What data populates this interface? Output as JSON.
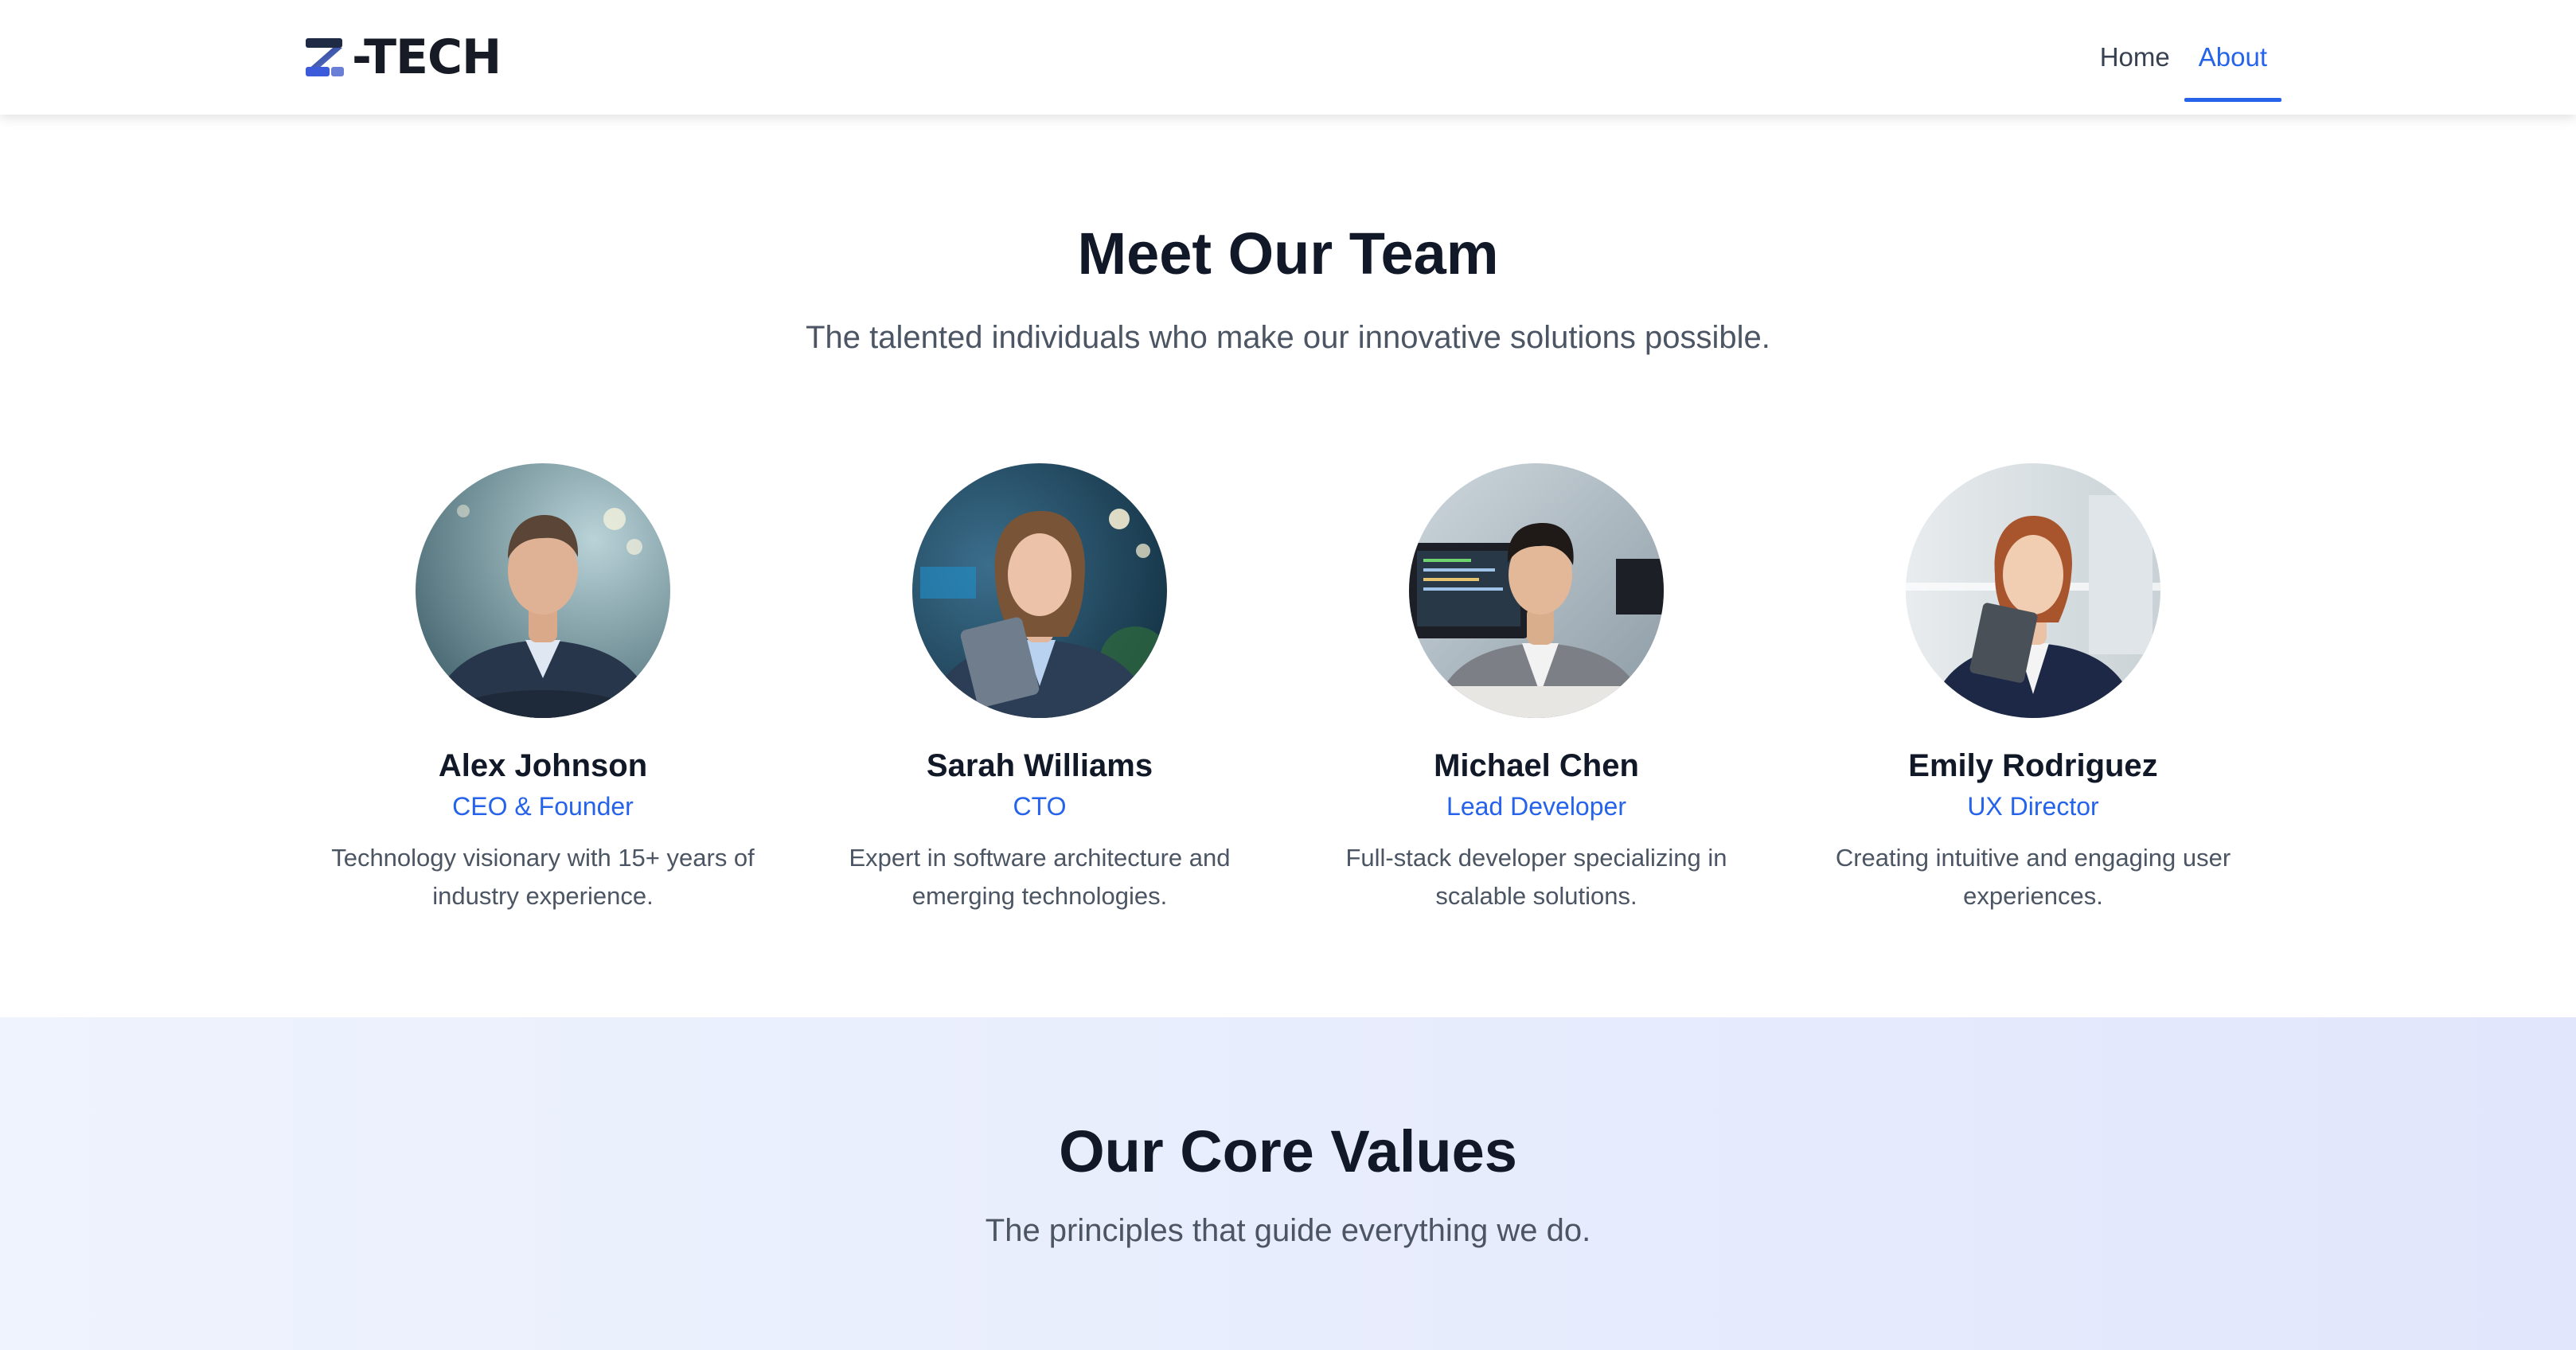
{
  "header": {
    "logo_text": "-TECH",
    "logo_letter": "Z",
    "nav": [
      {
        "label": "Home",
        "active": false
      },
      {
        "label": "About",
        "active": true
      }
    ]
  },
  "team": {
    "title": "Meet Our Team",
    "subtitle": "The talented individuals who make our innovative solutions possible.",
    "members": [
      {
        "name": "Alex Johnson",
        "role": "CEO & Founder",
        "bio": "Technology visionary with 15+ years of industry experience."
      },
      {
        "name": "Sarah Williams",
        "role": "CTO",
        "bio": "Expert in software architecture and emerging technologies."
      },
      {
        "name": "Michael Chen",
        "role": "Lead Developer",
        "bio": "Full-stack developer specializing in scalable solutions."
      },
      {
        "name": "Emily Rodriguez",
        "role": "UX Director",
        "bio": "Creating intuitive and engaging user experiences."
      }
    ]
  },
  "values": {
    "title": "Our Core Values",
    "subtitle": "The principles that guide everything we do."
  },
  "colors": {
    "accent": "#2563eb",
    "heading": "#111827",
    "body_text": "#4b5563"
  }
}
